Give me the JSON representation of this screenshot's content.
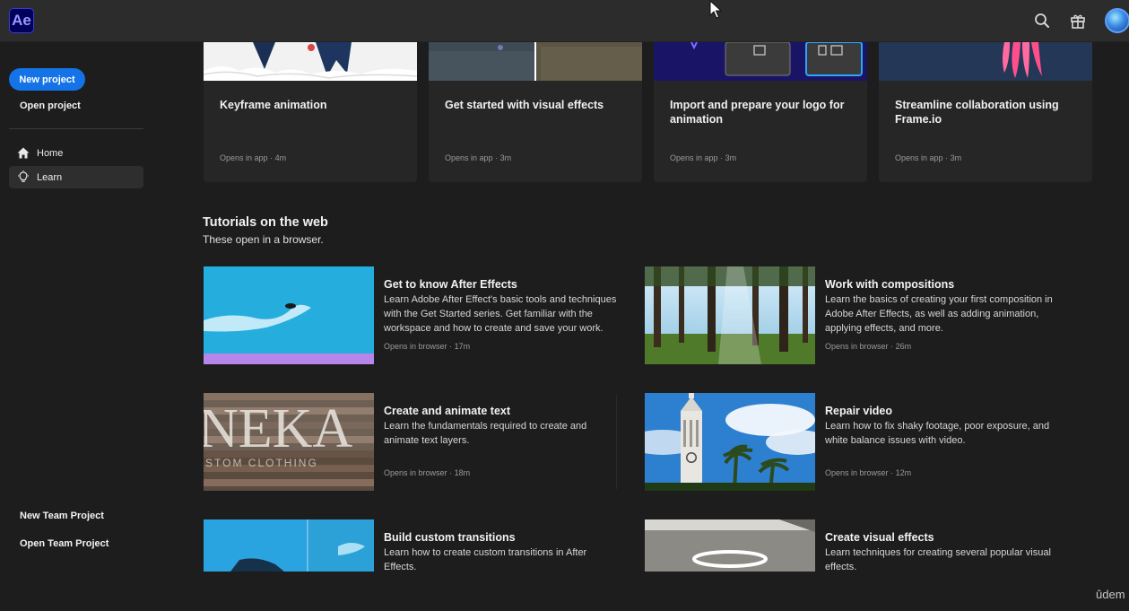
{
  "app": {
    "logo_text": "Ae"
  },
  "header": {
    "icons": [
      "search-icon",
      "gift-icon"
    ]
  },
  "sidebar": {
    "new_project": "New project",
    "open_project": "Open project",
    "nav": [
      {
        "label": "Home",
        "icon": "home-icon",
        "active": false
      },
      {
        "label": "Learn",
        "icon": "lightbulb-icon",
        "active": true
      }
    ],
    "new_team_project": "New Team Project",
    "open_team_project": "Open Team Project"
  },
  "app_tutorials": [
    {
      "title": "Keyframe animation",
      "opens": "Opens in app",
      "duration": "4m"
    },
    {
      "title": "Get started with visual effects",
      "opens": "Opens in app",
      "duration": "3m"
    },
    {
      "title": "Import and prepare your logo for animation",
      "opens": "Opens in app",
      "duration": "3m"
    },
    {
      "title": "Streamline collaboration using Frame.io",
      "opens": "Opens in app",
      "duration": "3m"
    }
  ],
  "web_section": {
    "title": "Tutorials on the web",
    "subtitle": "These open in a browser."
  },
  "web_tutorials": [
    {
      "title": "Get to know After Effects",
      "desc": "Learn Adobe After Effect's basic tools and techniques with the Get Started series. Get familiar with the workspace and how to create and save your work.",
      "opens": "Opens in browser",
      "duration": "17m"
    },
    {
      "title": "Work with compositions",
      "desc": "Learn the basics of creating your first composition in Adobe After Effects, as well as adding animation, applying effects, and more.",
      "opens": "Opens in browser",
      "duration": "26m"
    },
    {
      "title": "Create and animate text",
      "desc": "Learn the fundamentals required to create and animate text layers.",
      "opens": "Opens in browser",
      "duration": "18m",
      "thumb_text_1": "NEKA",
      "thumb_text_2": "STOM CLOTHING"
    },
    {
      "title": "Repair video",
      "desc": "Learn how to fix shaky footage, poor exposure, and white balance issues with video.",
      "opens": "Opens in browser",
      "duration": "12m"
    },
    {
      "title": "Build custom transitions",
      "desc": "Learn how to create custom transitions in After Effects."
    },
    {
      "title": "Create visual effects",
      "desc": "Learn techniques for creating several popular visual effects."
    }
  ],
  "watermark": "ûdem",
  "meta_separator": "·"
}
